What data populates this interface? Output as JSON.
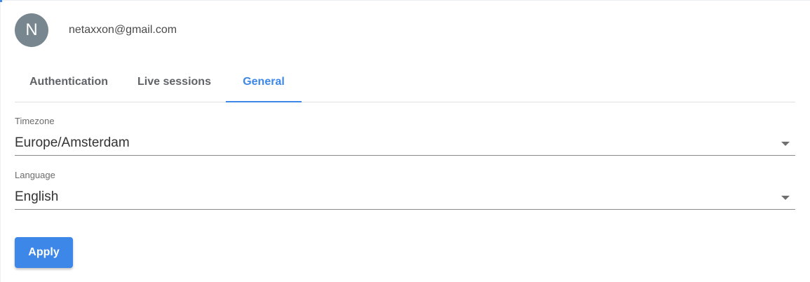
{
  "user": {
    "avatar_letter": "N",
    "email": "netaxxon@gmail.com"
  },
  "tabs": [
    {
      "label": "Authentication",
      "active": false
    },
    {
      "label": "Live sessions",
      "active": false
    },
    {
      "label": "General",
      "active": true
    }
  ],
  "fields": {
    "timezone": {
      "label": "Timezone",
      "value": "Europe/Amsterdam",
      "icon": "dropdown-arrow-icon"
    },
    "language": {
      "label": "Language",
      "value": "English",
      "icon": "dropdown-arrow-icon"
    }
  },
  "actions": {
    "apply_label": "Apply"
  },
  "colors": {
    "accent": "#3c87e8",
    "avatar_bg": "#78868f"
  }
}
